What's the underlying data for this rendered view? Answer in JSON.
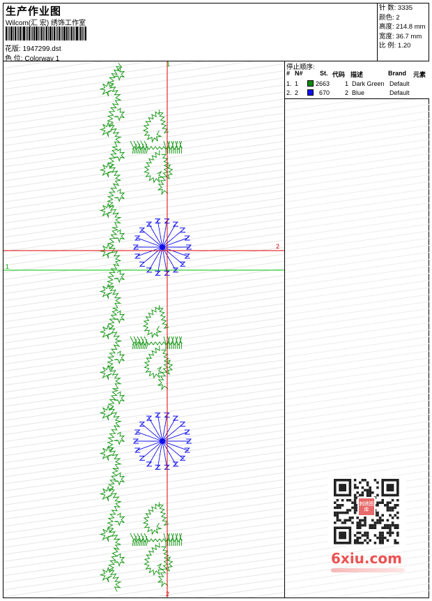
{
  "header": {
    "title": "生产作业图",
    "company": "Wilcom(汇 宏) 绣饰工作室",
    "design_label": "花版:",
    "design_value": "1947299.dst",
    "colorway_label": "色 位:",
    "colorway_value": "Colorway 1"
  },
  "stats": {
    "stitches_label": "针 数:",
    "stitches_value": "3335",
    "colors_label": "颜色:",
    "colors_value": "2",
    "height_label": "高度:",
    "height_value": "214.8 mm",
    "width_label": "宽度:",
    "width_value": "36.7 mm",
    "scale_label": "比 例:",
    "scale_value": "1.20"
  },
  "canvas": {
    "axis_v_top": "1",
    "axis_v_bottom": "2",
    "axis_h_left": "1",
    "axis_h_right": "2",
    "colors": {
      "red_axis": "#e00000",
      "green_axis": "#00c000",
      "green_thread": "#1e9a1e",
      "blue_thread": "#1010ee"
    }
  },
  "stop_sequence": {
    "label": "停止顺序:",
    "columns": [
      "#",
      "N#",
      "St.",
      "代码",
      "描述",
      "Brand",
      "元素"
    ],
    "rows": [
      {
        "idx": "1.",
        "n": "1",
        "color": "#0a8a0a",
        "st": "2663",
        "code": "1",
        "desc": "Dark Green",
        "brand": "Default"
      },
      {
        "idx": "2.",
        "n": "2",
        "color": "#1010ee",
        "st": "670",
        "code": "2",
        "desc": "Blue",
        "brand": "Default"
      }
    ]
  },
  "watermark": {
    "text": "6xiu.com",
    "qr_badge": "刺绣图库"
  }
}
